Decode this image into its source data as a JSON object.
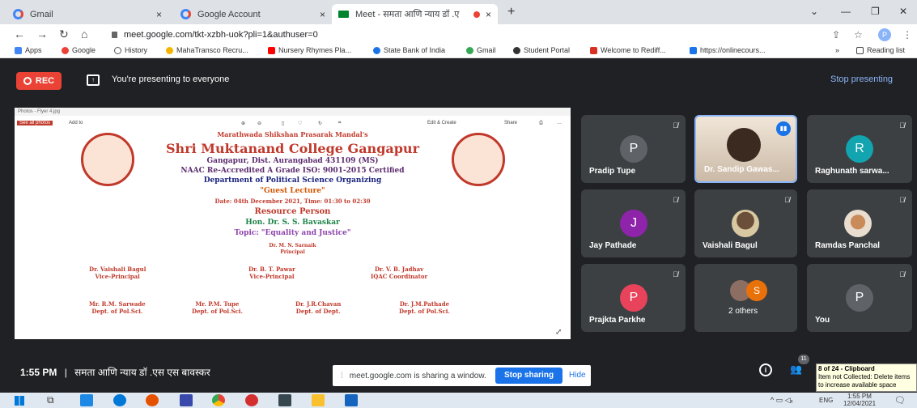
{
  "browser": {
    "tabs": [
      {
        "label": "Gmail"
      },
      {
        "label": "Google Account"
      },
      {
        "label": "Meet - समता आणि न्याय डॉ .ए"
      }
    ],
    "url": "meet.google.com/tkt-xzbh-uok?pli=1&authuser=0",
    "profile_initial": "P",
    "bookmarks": [
      "Apps",
      "Google",
      "History",
      "MahaTransco Recru...",
      "Nursery Rhymes Pla...",
      "State Bank of India",
      "Gmail",
      "Student Portal",
      "Welcome to Rediff...",
      "https://onlinecours..."
    ],
    "reading_list": "Reading list"
  },
  "presenting": {
    "rec_label": "REC",
    "message": "You're presenting to everyone",
    "stop_label": "Stop presenting"
  },
  "photos_window": {
    "title": "Photos - Flyer 4.jpg",
    "see_all": "See all photos",
    "add_to": "Add to",
    "edit_create": "Edit & Create",
    "share": "Share"
  },
  "flyer": {
    "org": "Marathwada Shikshan Prasarak Mandal's",
    "college": "Shri Muktanand College Gangapur",
    "address": "Gangapur, Dist. Aurangabad 431109 (MS)",
    "naac": "NAAC Re-Accredited A Grade ISO: 9001-2015 Certified",
    "dept": "Department of Political Science Organizing",
    "event": "\"Guest Lecture\"",
    "date": "Date: 04th December 2021, Time: 01:30 to 02:30",
    "resource_heading": "Resource Person",
    "speaker": "Hon. Dr. S. S. Bavaskar",
    "topic": "Topic: \"Equality and Justice\"",
    "principal_name": "Dr. M. N. Sarnaik",
    "principal_title": "Principal",
    "row1": [
      {
        "name": "Dr. Vaishali Bagul",
        "title": "Vice-Principal"
      },
      {
        "name": "Dr. B. T. Pawar",
        "title": "Vice-Principal"
      },
      {
        "name": "Dr. V. B. Jadhav",
        "title": "IQAC Coordinator"
      }
    ],
    "row2": [
      {
        "name": "Mr. R.M. Sarwade",
        "title": "Dept. of Pol.Sci."
      },
      {
        "name": "Mr. P.M. Tupe",
        "title": "Dept. of Pol.Sci."
      },
      {
        "name": "Dr. J.R.Chavan",
        "title": "Dept. of Dept."
      },
      {
        "name": "Dr. J.M.Pathade",
        "title": "Dept. of Pol.Sci."
      }
    ]
  },
  "participants": [
    {
      "name": "Pradip Tupe",
      "initial": "P",
      "color": "#5f6368"
    },
    {
      "name": "Dr. Sandip Gawas...",
      "initial": "",
      "color": ""
    },
    {
      "name": "Raghunath sarwa...",
      "initial": "R",
      "color": "#12a4af"
    },
    {
      "name": "Jay Pathade",
      "initial": "J",
      "color": "#8e24aa"
    },
    {
      "name": "Vaishali Bagul",
      "initial": "",
      "color": ""
    },
    {
      "name": "Ramdas Panchal",
      "initial": "",
      "color": ""
    },
    {
      "name": "Prajkta Parkhe",
      "initial": "P",
      "color": "#e8435a"
    },
    {
      "name": "2 others",
      "initial": "S",
      "color": "#e8710a"
    },
    {
      "name": "You",
      "initial": "P",
      "color": "#5f6368"
    }
  ],
  "bottom": {
    "time": "1:55 PM",
    "meeting_title": "समता आणि न्याय डॉ .एस एस बावस्कर",
    "participant_count": "11"
  },
  "share_banner": {
    "text": "meet.google.com is sharing a window.",
    "stop_label": "Stop sharing",
    "hide_label": "Hide"
  },
  "notification": {
    "title": "8 of 24 - Clipboard",
    "body": "Item not Collected: Delete items to increase available space"
  },
  "taskbar": {
    "lang": "ENG",
    "time": "1:55 PM",
    "date": "12/04/2021"
  }
}
